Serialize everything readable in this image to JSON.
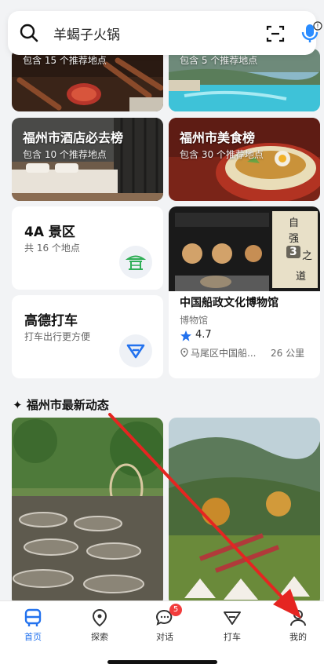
{
  "search": {
    "query": "羊蝎子火锅"
  },
  "top_cards": [
    {
      "subtitle": "包含 15 个推荐地点"
    },
    {
      "subtitle": "包含 5 个推荐地点"
    }
  ],
  "rank_cards": [
    {
      "title": "福州市酒店必去榜",
      "subtitle": "包含 10 个推荐地点"
    },
    {
      "title": "福州市美食榜",
      "subtitle": "包含 30 个推荐地点"
    }
  ],
  "scenic": {
    "title": "4A 景区",
    "subtitle": "共 16 个地点"
  },
  "taxi": {
    "title": "高德打车",
    "subtitle": "打车出行更方便"
  },
  "museum": {
    "title": "中国船政文化博物馆",
    "type": "博物馆",
    "rating": "4.7",
    "location": "马尾区中国船...",
    "distance": "26 公里",
    "sign_chars": [
      "自",
      "强",
      "之",
      "道"
    ],
    "photo_count": "3"
  },
  "feed": {
    "title": "福州市最新动态",
    "sparkle": "✦"
  },
  "nav": [
    {
      "label": "首页"
    },
    {
      "label": "探索"
    },
    {
      "label": "对话",
      "badge": "5"
    },
    {
      "label": "打车"
    },
    {
      "label": "我的"
    }
  ],
  "colors": {
    "accent": "#2372ee",
    "badge": "#f23c3c",
    "arrow": "#e52521",
    "icon_green": "#2fae56"
  }
}
